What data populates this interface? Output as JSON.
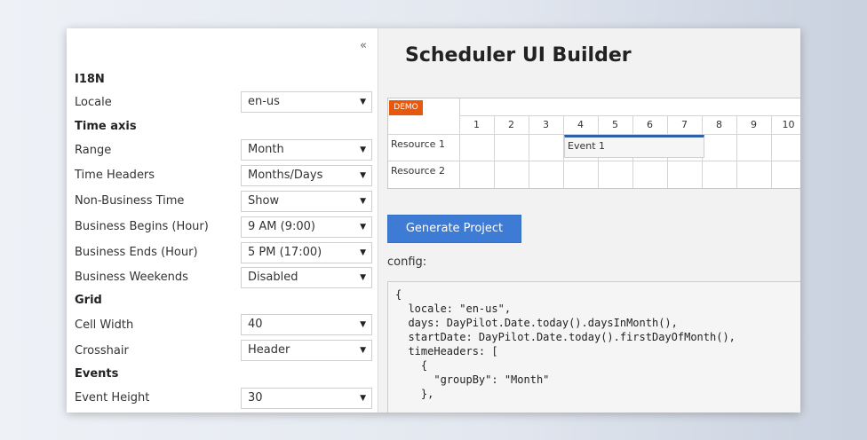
{
  "left_panel": {
    "collapse_glyph": "«",
    "sections": {
      "i18n": "I18N",
      "time_axis": "Time axis",
      "grid": "Grid",
      "events": "Events"
    },
    "fields": [
      {
        "label": "Locale",
        "value": "en-us"
      },
      {
        "label": "Range",
        "value": "Month"
      },
      {
        "label": "Time Headers",
        "value": "Months/Days"
      },
      {
        "label": "Non-Business Time",
        "value": "Show"
      },
      {
        "label": "Business Begins (Hour)",
        "value": "9 AM (9:00)"
      },
      {
        "label": "Business Ends (Hour)",
        "value": "5 PM (17:00)"
      },
      {
        "label": "Business Weekends",
        "value": "Disabled"
      },
      {
        "label": "Cell Width",
        "value": "40"
      },
      {
        "label": "Crosshair",
        "value": "Header"
      },
      {
        "label": "Event Height",
        "value": "30"
      }
    ],
    "dropdown_icon": "triangle-down"
  },
  "main": {
    "title": "Scheduler UI Builder",
    "scheduler": {
      "demo_badge": "DEMO",
      "days": [
        "1",
        "2",
        "3",
        "4",
        "5",
        "6",
        "7",
        "8",
        "9",
        "10"
      ],
      "resources": [
        "Resource 1",
        "Resource 2"
      ],
      "event": {
        "text": "Event 1"
      }
    },
    "generate_button": "Generate Project",
    "config_label": "config:",
    "config_code": "{\n  locale: \"en-us\",\n  days: DayPilot.Date.today().daysInMonth(),\n  startDate: DayPilot.Date.today().firstDayOfMonth(),\n  timeHeaders: [\n    {\n      \"groupBy\": \"Month\"\n    },"
  },
  "colors": {
    "accent_button": "#3d7bd4",
    "demo_badge": "#e8580c",
    "event_bar": "#2f5fa8"
  }
}
